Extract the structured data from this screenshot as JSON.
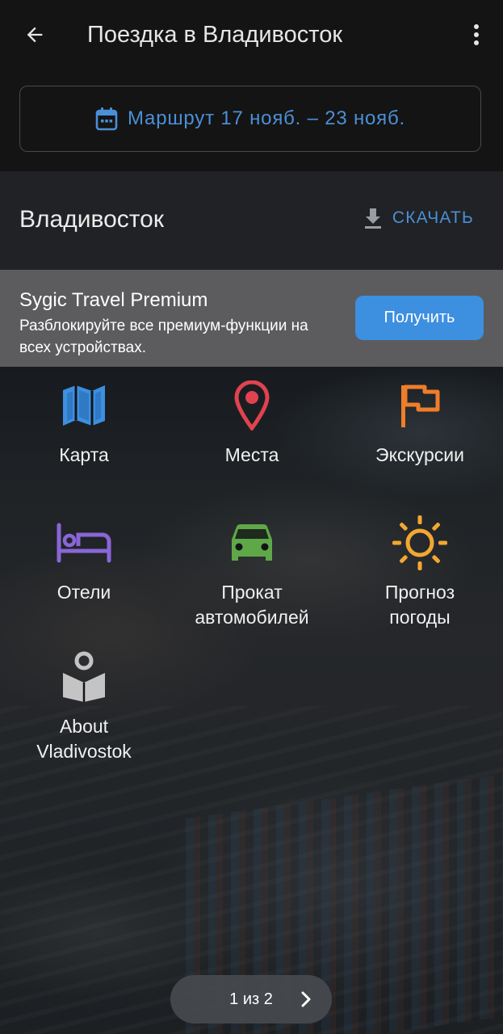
{
  "appbar": {
    "title": "Поездка в Владивосток",
    "route_label": "Маршрут 17 нояб. – 23 нояб.",
    "back_icon": "arrow-back-icon",
    "menu_icon": "more-vert-icon"
  },
  "city": {
    "name": "Владивосток",
    "download_label": "СКАЧАТЬ"
  },
  "premium": {
    "title": "Sygic Travel Premium",
    "description": "Разблокируйте все премиум-функции на всех устройствах.",
    "button_label": "Получить"
  },
  "tiles": [
    {
      "label": "Карта",
      "icon": "map-icon",
      "color": "#3d8fe0"
    },
    {
      "label": "Места",
      "icon": "pin-icon",
      "color": "#e0434f"
    },
    {
      "label": "Экскурсии",
      "icon": "flag-icon",
      "color": "#f07d2a"
    },
    {
      "label": "Отели",
      "icon": "bed-icon",
      "color": "#8a66d8"
    },
    {
      "label": "Прокат\nавтомобилей",
      "icon": "car-icon",
      "color": "#5ea848"
    },
    {
      "label": "Прогноз\nпогоды",
      "icon": "sun-icon",
      "color": "#f2a733"
    },
    {
      "label": "About\nVladivostok",
      "icon": "guide-book-icon",
      "color": "#c4c4c4"
    }
  ],
  "pager": {
    "label": "1 из 2"
  },
  "colors": {
    "accent": "#4b8fd6",
    "button": "#3d8fe0",
    "appbar_bg": "#141414",
    "city_bg": "#202225",
    "premium_bg": "#5c5c5e"
  }
}
